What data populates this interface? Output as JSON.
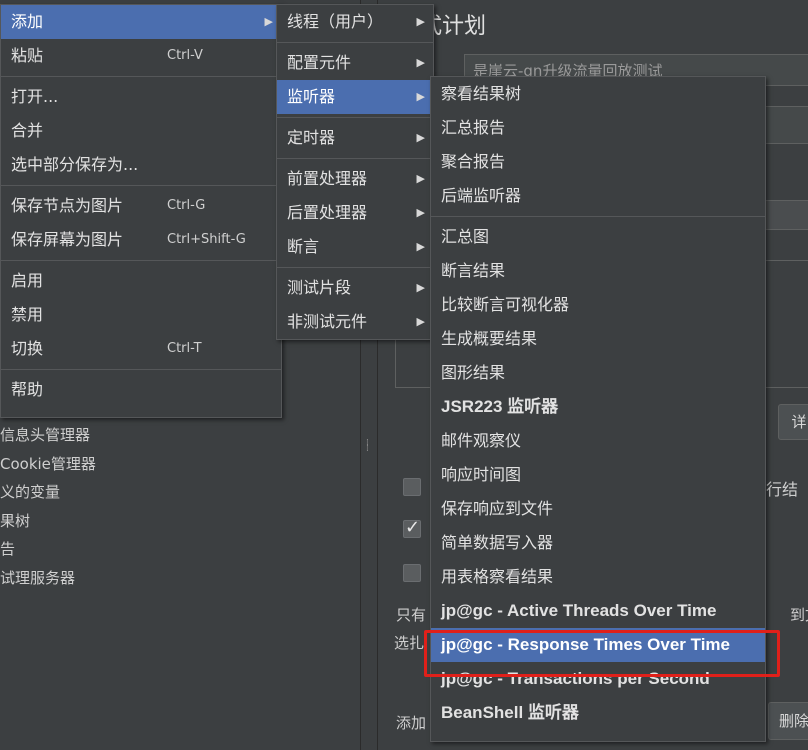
{
  "background": {
    "tree_items": [
      "信息头管理器",
      "Cookie管理器",
      "义的变量",
      "果树",
      "告",
      "试理服务器"
    ],
    "plan_title": "式计划",
    "name_field_value": "是崖云-gn升级流量回放测试",
    "right_label_1": "行结",
    "right_label_2": "到文",
    "only_text": "只有",
    "select_text": "选扎",
    "add_text": "添加",
    "delete_button": "删除",
    "cut_button": "详"
  },
  "main_menu": {
    "items": [
      {
        "label": "添加",
        "selected": true,
        "arrow": true
      },
      {
        "label": "粘贴",
        "shortcut": "Ctrl-V"
      },
      {
        "sep": true
      },
      {
        "label": "打开..."
      },
      {
        "label": "合并"
      },
      {
        "label": "选中部分保存为..."
      },
      {
        "sep": true
      },
      {
        "label": "保存节点为图片",
        "shortcut": "Ctrl-G"
      },
      {
        "label": "保存屏幕为图片",
        "shortcut": "Ctrl+Shift-G"
      },
      {
        "sep": true
      },
      {
        "label": "启用"
      },
      {
        "label": "禁用"
      },
      {
        "label": "切换",
        "shortcut": "Ctrl-T"
      },
      {
        "sep": true
      },
      {
        "label": "帮助"
      }
    ]
  },
  "add_menu": {
    "items": [
      {
        "label": "线程（用户）",
        "arrow": true
      },
      {
        "sep": true
      },
      {
        "label": "配置元件",
        "arrow": true
      },
      {
        "label": "监听器",
        "arrow": true,
        "selected": true
      },
      {
        "sep": true
      },
      {
        "label": "定时器",
        "arrow": true
      },
      {
        "sep": true
      },
      {
        "label": "前置处理器",
        "arrow": true
      },
      {
        "label": "后置处理器",
        "arrow": true
      },
      {
        "label": "断言",
        "arrow": true
      },
      {
        "sep": true
      },
      {
        "label": "测试片段",
        "arrow": true
      },
      {
        "label": "非测试元件",
        "arrow": true
      }
    ]
  },
  "listener_menu": {
    "items": [
      {
        "label": "察看结果树"
      },
      {
        "label": "汇总报告"
      },
      {
        "label": "聚合报告"
      },
      {
        "label": "后端监听器"
      },
      {
        "sep": true
      },
      {
        "label": "汇总图"
      },
      {
        "label": "断言结果"
      },
      {
        "label": "比较断言可视化器"
      },
      {
        "label": "生成概要结果"
      },
      {
        "label": "图形结果"
      },
      {
        "label": "JSR223 监听器",
        "en": true
      },
      {
        "label": "邮件观察仪"
      },
      {
        "label": "响应时间图"
      },
      {
        "label": "保存响应到文件"
      },
      {
        "label": "简单数据写入器"
      },
      {
        "label": "用表格察看结果"
      },
      {
        "label": "jp@gc - Active Threads Over Time",
        "en": true
      },
      {
        "label": "jp@gc - Response Times Over Time",
        "en": true,
        "selected": true
      },
      {
        "label": "jp@gc - Transactions per Second",
        "en": true
      },
      {
        "label": "BeanShell 监听器",
        "en": true
      }
    ]
  },
  "colors": {
    "menu_bg": "#3c3f41",
    "selected": "#4b6eaf",
    "highlight_box": "#e0201a"
  }
}
